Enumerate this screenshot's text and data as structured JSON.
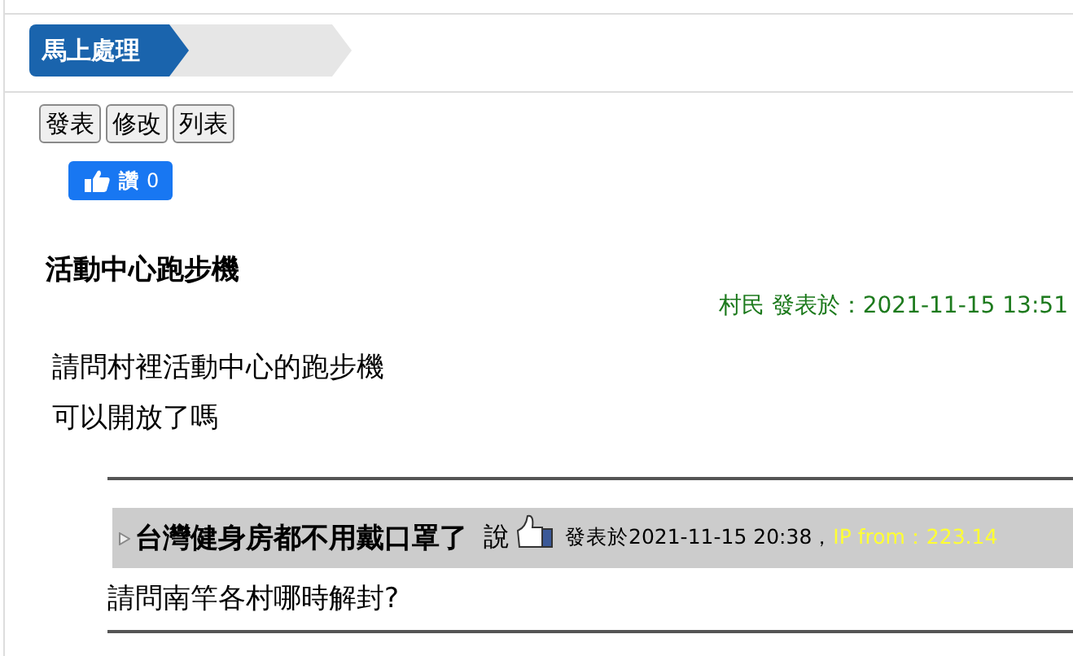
{
  "breadcrumb": {
    "label": "馬上處理"
  },
  "buttons": [
    "發表",
    "修改",
    "列表"
  ],
  "like": {
    "label": "讚",
    "count": "0"
  },
  "post": {
    "title": "活動中心跑步機",
    "meta": "村民 發表於：2021-11-15 13:51",
    "body": [
      "請問村裡活動中心的跑步機",
      "可以開放了嗎"
    ]
  },
  "replies": [
    {
      "title": "台灣健身房都不用戴口罩了",
      "said": "說",
      "meta": "發表於2021-11-15 20:38，",
      "ip": "IP from：223.14",
      "body": "請問南竿各村哪時解封?"
    }
  ]
}
